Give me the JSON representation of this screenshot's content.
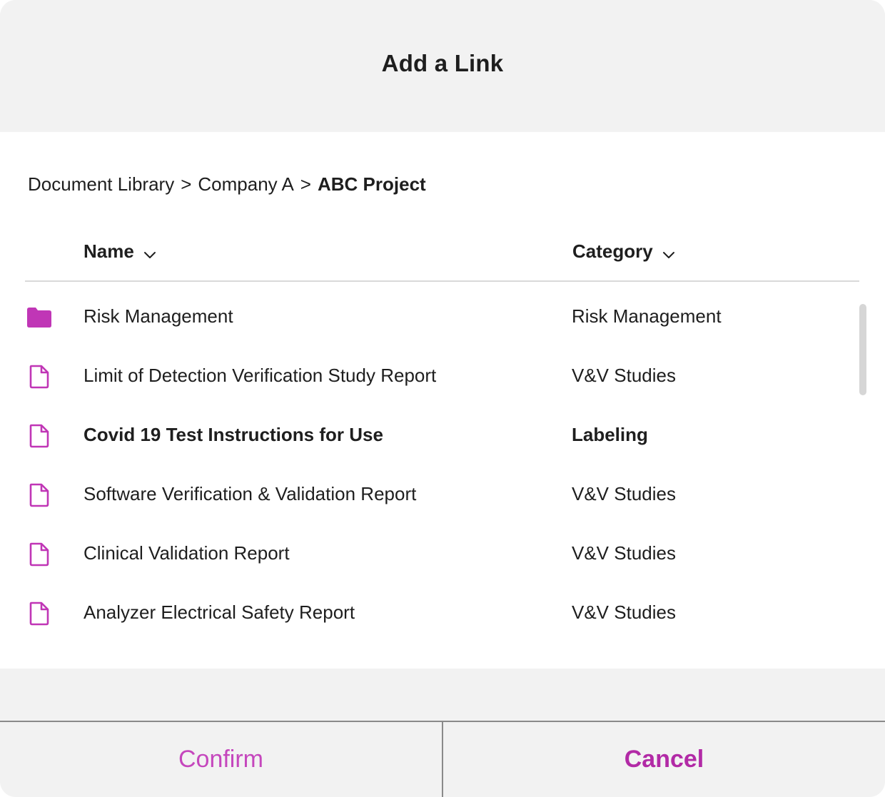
{
  "dialog": {
    "title": "Add a Link"
  },
  "breadcrumb": {
    "items": [
      "Document Library",
      "Company A"
    ],
    "separator": ">",
    "current": "ABC Project"
  },
  "table": {
    "columns": [
      {
        "label": "Name",
        "sort_icon": "chevron-down-icon"
      },
      {
        "label": "Category",
        "sort_icon": "chevron-down-icon"
      }
    ],
    "rows": [
      {
        "icon": "folder-icon",
        "name": "Risk Management",
        "category": "Risk Management",
        "selected": false
      },
      {
        "icon": "document-icon",
        "name": "Limit of Detection Verification Study Report",
        "category": "V&V Studies",
        "selected": false
      },
      {
        "icon": "document-icon",
        "name": "Covid 19 Test Instructions for Use",
        "category": "Labeling",
        "selected": true
      },
      {
        "icon": "document-icon",
        "name": "Software Verification & Validation Report",
        "category": "V&V Studies",
        "selected": false
      },
      {
        "icon": "document-icon",
        "name": "Clinical Validation Report",
        "category": "V&V Studies",
        "selected": false
      },
      {
        "icon": "document-icon",
        "name": "Analyzer Electrical Safety Report",
        "category": "V&V Studies",
        "selected": false
      }
    ]
  },
  "footer": {
    "confirm_label": "Confirm",
    "cancel_label": "Cancel"
  },
  "colors": {
    "accent": "#b52ba8",
    "icon": "#c036b6",
    "background": "#f2f2f2",
    "text": "#1e1e1e"
  }
}
